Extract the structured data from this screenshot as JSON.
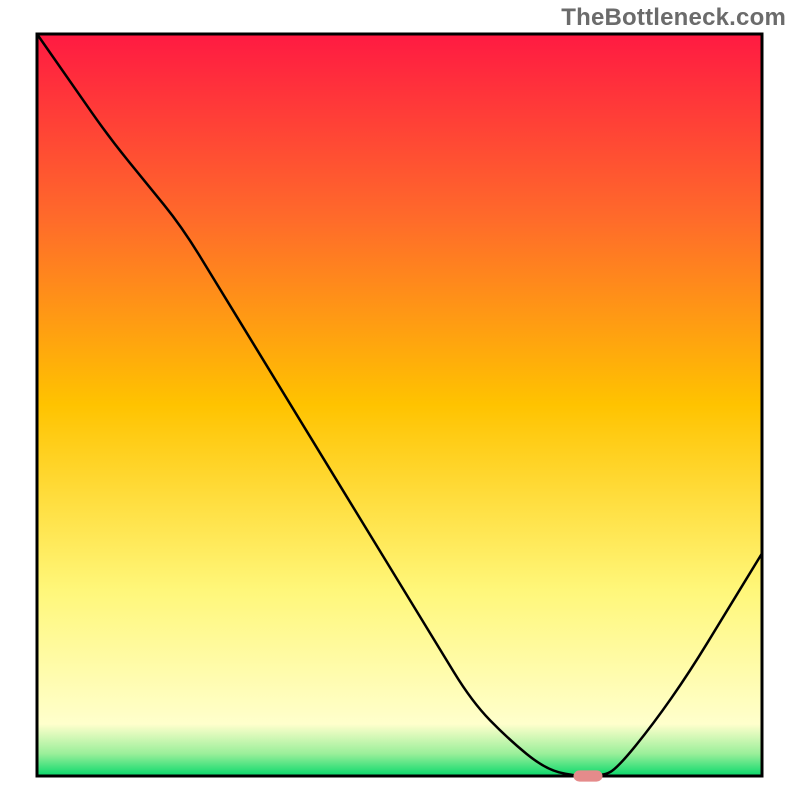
{
  "watermark": "TheBottleneck.com",
  "chart_data": {
    "type": "line",
    "title": "",
    "xlabel": "",
    "ylabel": "",
    "xlim": [
      0,
      100
    ],
    "ylim": [
      0,
      100
    ],
    "grid": false,
    "series": [
      {
        "name": "bottleneck-curve",
        "x": [
          0,
          5,
          10,
          15,
          20,
          25,
          30,
          35,
          40,
          45,
          50,
          55,
          60,
          65,
          70,
          74,
          78,
          80,
          85,
          90,
          95,
          100
        ],
        "values": [
          100,
          93,
          86,
          80,
          74,
          66,
          58,
          50,
          42,
          34,
          26,
          18,
          10,
          5,
          1,
          0,
          0,
          1,
          7,
          14,
          22,
          30
        ]
      }
    ],
    "marker": {
      "name": "optimal-point",
      "x": 76,
      "y": 0,
      "color": "#e58b8b",
      "width_x": 4,
      "height_y": 1.5
    },
    "background_gradient": {
      "stops": [
        {
          "offset": 0.0,
          "color": "#ff1a42"
        },
        {
          "offset": 0.25,
          "color": "#ff6b2a"
        },
        {
          "offset": 0.5,
          "color": "#ffc300"
        },
        {
          "offset": 0.75,
          "color": "#fff77a"
        },
        {
          "offset": 0.93,
          "color": "#ffffcc"
        },
        {
          "offset": 0.97,
          "color": "#9aef9a"
        },
        {
          "offset": 1.0,
          "color": "#08d86b"
        }
      ]
    },
    "axis_color": "#000000"
  }
}
